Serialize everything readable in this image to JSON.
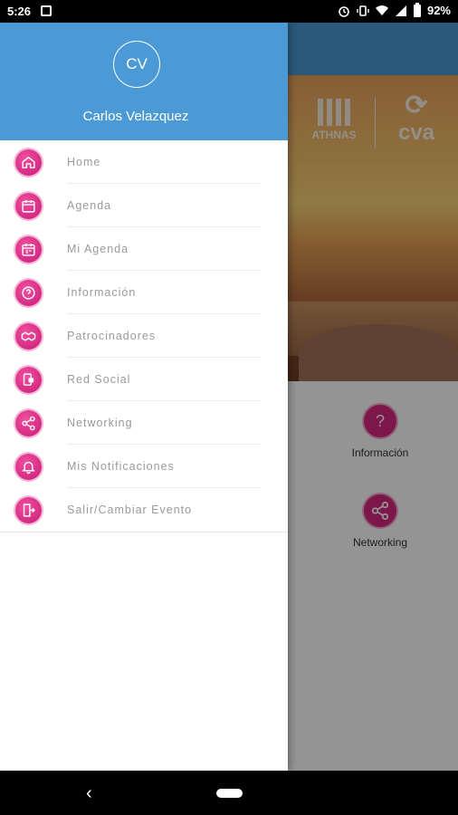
{
  "status_bar": {
    "time": "5:26",
    "battery": "92%",
    "icons": [
      "notification-icon",
      "alarm-icon",
      "vibrate-icon",
      "wifi-icon",
      "signal-icon",
      "battery-icon"
    ]
  },
  "background_app": {
    "banner_logos": [
      "ATHNAS",
      "cva"
    ],
    "grid": [
      {
        "label": "Información",
        "icon": "question-icon"
      },
      {
        "label": "Networking",
        "icon": "share-icon"
      }
    ]
  },
  "drawer": {
    "avatar_initials": "CV",
    "user_name": "Carlos Velazquez",
    "items": [
      {
        "label": "Home",
        "icon": "home-icon"
      },
      {
        "label": "Agenda",
        "icon": "calendar-icon"
      },
      {
        "label": "Mi Agenda",
        "icon": "my-calendar-icon"
      },
      {
        "label": "Información",
        "icon": "question-icon"
      },
      {
        "label": "Patrocinadores",
        "icon": "handshake-icon"
      },
      {
        "label": "Red Social",
        "icon": "social-icon"
      },
      {
        "label": "Networking",
        "icon": "share-icon"
      },
      {
        "label": "Mis Notificaciones",
        "icon": "bell-icon"
      },
      {
        "label": "Salir/Cambiar Evento",
        "icon": "exit-icon"
      }
    ]
  },
  "colors": {
    "primary": "#4b9ad5",
    "accent": "#d8267f"
  }
}
